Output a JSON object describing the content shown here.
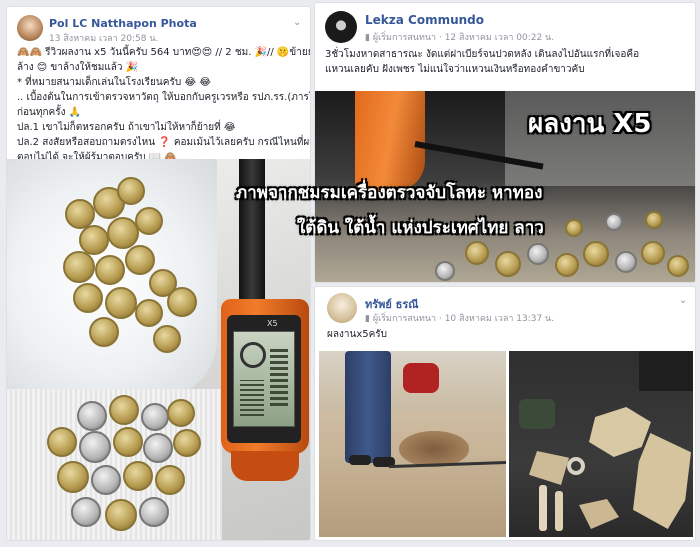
{
  "overlay": {
    "badge": "ผลงาน X5",
    "line1": "ภาพจากชมรมเครื่องตรวจจับโลหะ  หาทอง",
    "line2": "ใต้ดิน ใต้น้ำ แห่งประเทศไทย ลาว"
  },
  "post1": {
    "author": "Pol LC Natthapon Phota",
    "timestamp": "13 สิงหาคม เวลา 20:58 น.",
    "lines": [
      "🙈🙈 รีวิวผลงาน x5 วันนี้ครับ 564 บาท😍😍 // 2 ชม. 🎉// 🤫ข้ายยังไม่",
      "ล้าง 😊 ขาล้างให้ชมแล้ว 🎉",
      "* ที่หมายสนามเด็กเล่นในโรงเรียนครับ 😂 😂",
      ".. เบื้องต้นในการเข้าตรวจหาวัตถุ ให้บอกกับครูเวรหรือ รปภ.รร.(ภารโรง)",
      "ก่อนทุกครั้ง 🙏",
      "ปล.1 เขาไม่ก็ตหรอกครับ ถ้าเขาไม่ให้หาก็ย้ายที่ 😂",
      "ปล.2 สงสัยหรือสอบถามตรงไหน ❓ คอมเม้นไว้เลยครับ กรณีไหนที่ผม",
      "ตอบไม่ได้ จะให้ผู้รู้มาตอบครับ 📖 🙈"
    ],
    "device_label": "X5"
  },
  "post2": {
    "author": "Lekza Commundo",
    "group_label": "ผู้เริ่มการสนทนา",
    "timestamp": "12 สิงหาคม เวลา 00:22 น.",
    "lines": [
      "3ชั่วโมงหาดสาธารณะ งัดแต่ฝาเบียร์จนปวดหลัง เดินลงไปอันแรกที่เจอคือ",
      "แหวนเลยคับ ฝังเพชร ไม่แน่ใจว่าแหวนเงินหรือทองคำขาวคับ"
    ]
  },
  "post3": {
    "author": "ทรัพย์ ธรณี",
    "group_label": "ผู้เริ่มการสนทนา",
    "timestamp": "10 สิงหาคม เวลา 13:37 น.",
    "text": "ผลงานx5ครับ"
  }
}
